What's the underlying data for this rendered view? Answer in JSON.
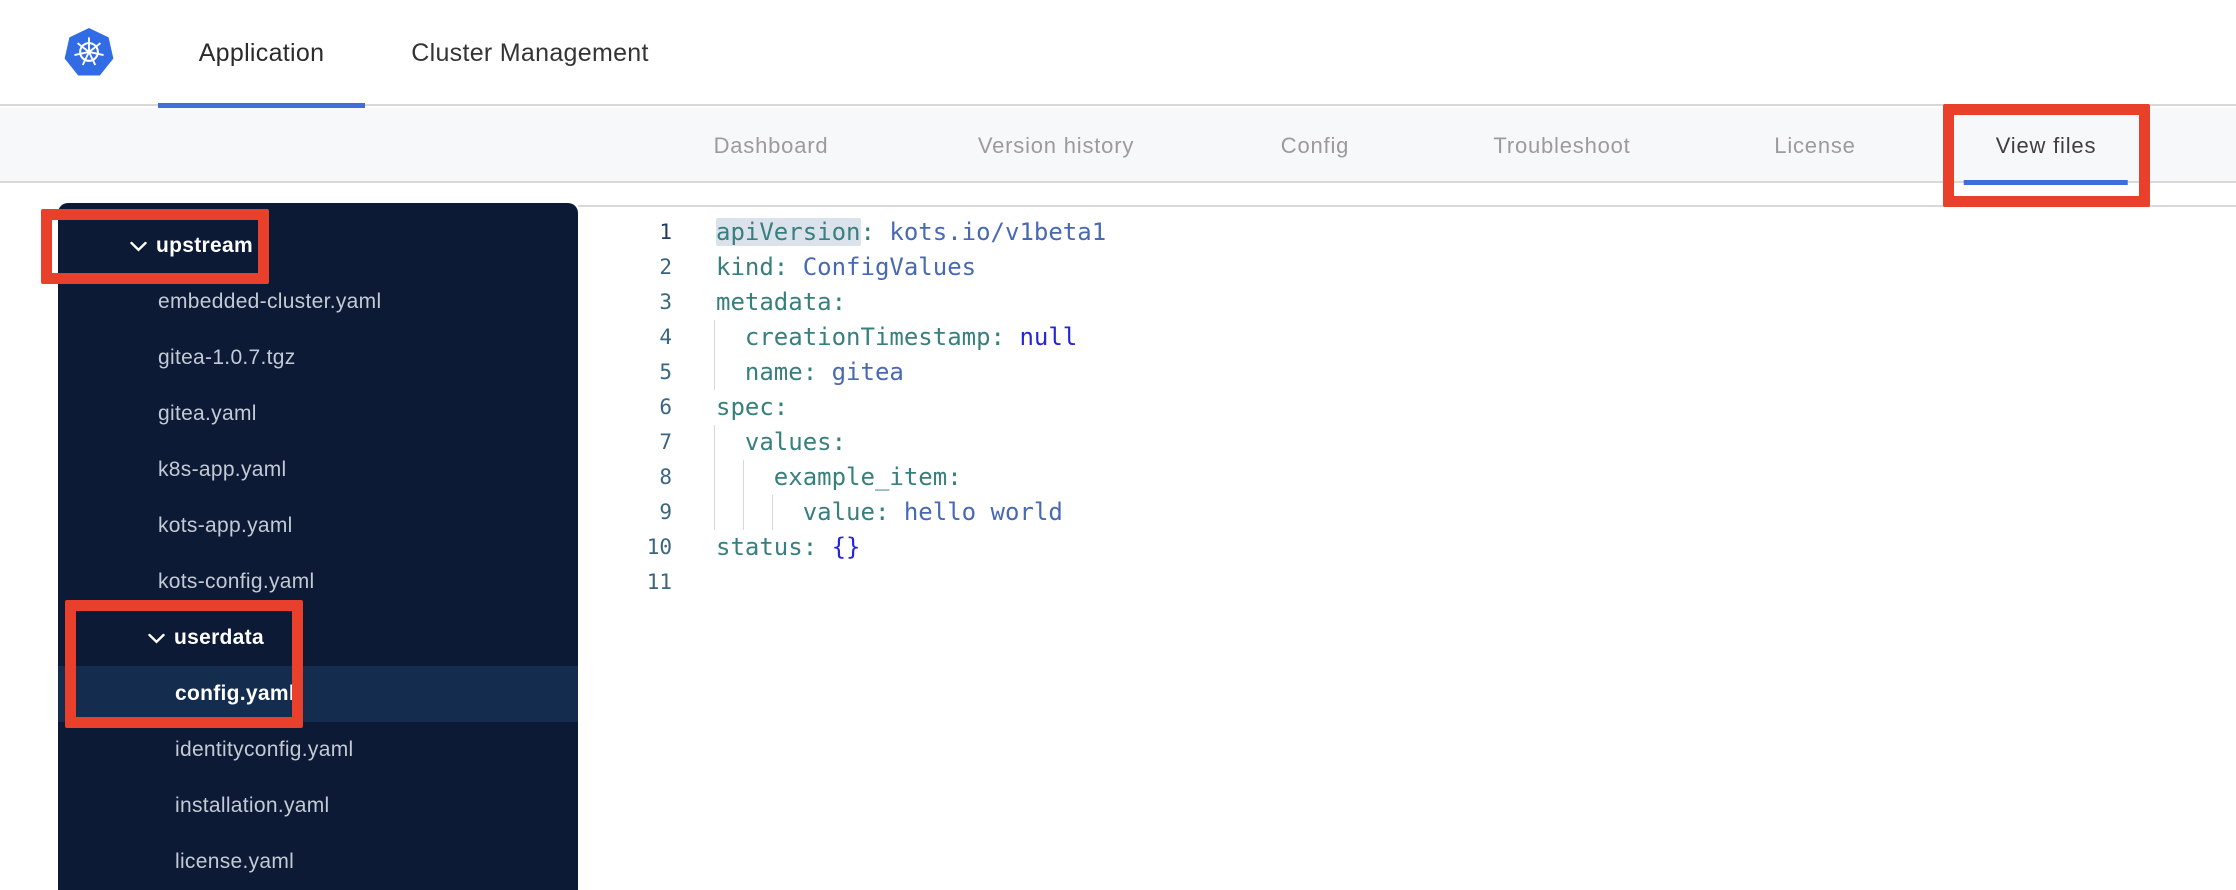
{
  "topbar": {
    "logo": "kubernetes",
    "tabs": [
      {
        "label": "Application",
        "active": true
      },
      {
        "label": "Cluster Management",
        "active": false
      }
    ]
  },
  "subnav": {
    "tabs": [
      {
        "label": "Dashboard",
        "active": false
      },
      {
        "label": "Version history",
        "active": false
      },
      {
        "label": "Config",
        "active": false
      },
      {
        "label": "Troubleshoot",
        "active": false
      },
      {
        "label": "License",
        "active": false
      },
      {
        "label": "View files",
        "active": true
      }
    ]
  },
  "sidebar": {
    "items": [
      {
        "label": "upstream",
        "type": "folder",
        "state": "expanded"
      },
      {
        "label": "embedded-cluster.yaml",
        "type": "file"
      },
      {
        "label": "gitea-1.0.7.tgz",
        "type": "file"
      },
      {
        "label": "gitea.yaml",
        "type": "file"
      },
      {
        "label": "k8s-app.yaml",
        "type": "file"
      },
      {
        "label": "kots-app.yaml",
        "type": "file"
      },
      {
        "label": "kots-config.yaml",
        "type": "file"
      },
      {
        "label": "userdata",
        "type": "folder",
        "state": "expanded"
      },
      {
        "label": "config.yaml",
        "type": "file",
        "selected": true
      },
      {
        "label": "identityconfig.yaml",
        "type": "file"
      },
      {
        "label": "installation.yaml",
        "type": "file"
      },
      {
        "label": "license.yaml",
        "type": "file"
      }
    ]
  },
  "editor": {
    "file": "config.yaml",
    "lines": [
      {
        "num": "1",
        "tokens": {
          "t0": "apiVersion",
          "t1": ": ",
          "t2": "kots.io/v1beta1"
        }
      },
      {
        "num": "2",
        "tokens": {
          "t0": "kind",
          "t1": ": ",
          "t2": "ConfigValues"
        }
      },
      {
        "num": "3",
        "tokens": {
          "t0": "metadata",
          "t1": ":"
        }
      },
      {
        "num": "4",
        "tokens": {
          "t0": "  creationTimestamp",
          "t1": ": ",
          "t2": "null"
        }
      },
      {
        "num": "5",
        "tokens": {
          "t0": "  name",
          "t1": ": ",
          "t2": "gitea"
        }
      },
      {
        "num": "6",
        "tokens": {
          "t0": "spec",
          "t1": ":"
        }
      },
      {
        "num": "7",
        "tokens": {
          "t0": "  values",
          "t1": ":"
        }
      },
      {
        "num": "8",
        "tokens": {
          "t0": "    example_item",
          "t1": ":"
        }
      },
      {
        "num": "9",
        "tokens": {
          "t0": "      value",
          "t1": ": ",
          "t2": "hello world"
        }
      },
      {
        "num": "10",
        "tokens": {
          "t0": "status",
          "t1": ": ",
          "t2": "{}"
        }
      },
      {
        "num": "11",
        "tokens": {}
      }
    ]
  },
  "annotations": {
    "color": "#e8402b",
    "boxes": [
      {
        "target": "upstream-folder"
      },
      {
        "target": "userdata-folder-and-config-yaml"
      },
      {
        "target": "view-files-tab"
      }
    ]
  },
  "colors": {
    "kubernetes_blue": "#326ce5",
    "accent_blue": "#3f6fdb",
    "annotation_red": "#e8402b",
    "sidebar_bg": "#0c1a36",
    "sidebar_selected_bg": "#142c4e",
    "code_key": "#37807e",
    "code_value": "#4869b3",
    "code_constant": "#2626d8"
  }
}
